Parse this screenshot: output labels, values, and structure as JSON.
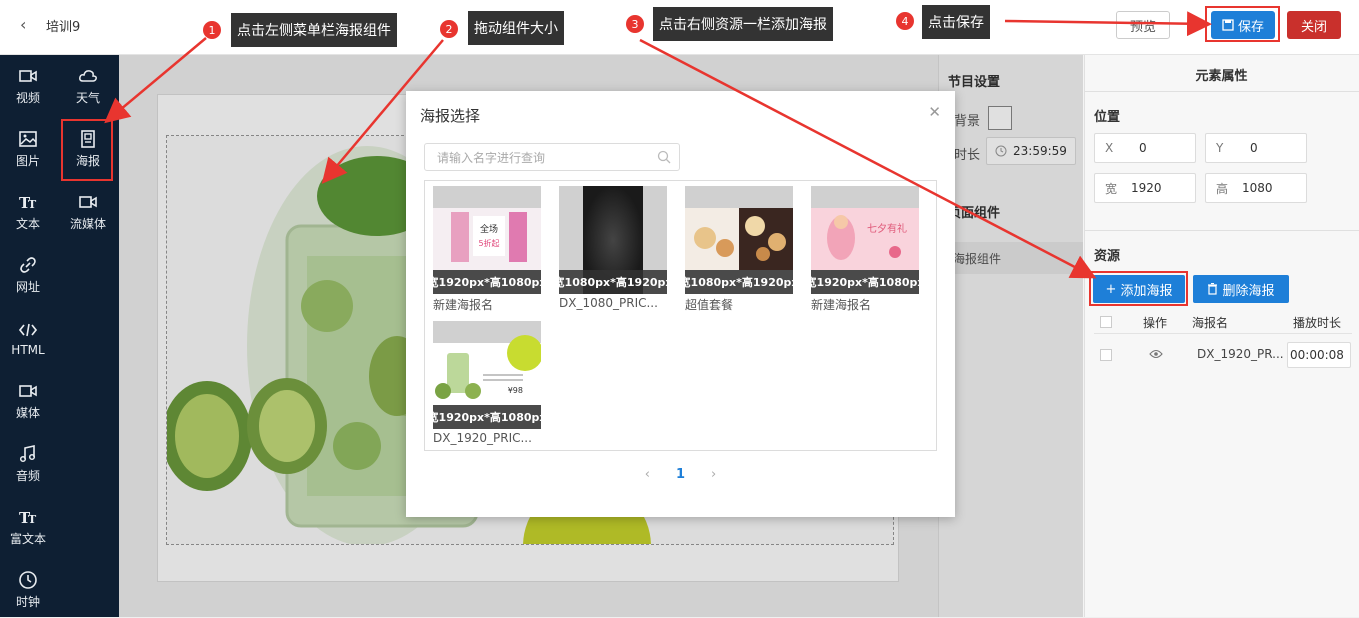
{
  "header": {
    "back_icon": "chevron-left-icon",
    "title": "培训9",
    "preview_label": "预览",
    "save_label": "保存",
    "close_label": "关闭"
  },
  "sidebar": {
    "items": [
      {
        "label": "视频",
        "icon": "video-icon"
      },
      {
        "label": "天气",
        "icon": "cloud-icon"
      },
      {
        "label": "图片",
        "icon": "image-icon"
      },
      {
        "label": "海报",
        "icon": "poster-icon"
      },
      {
        "label": "文本",
        "icon": "text-icon"
      },
      {
        "label": "流媒体",
        "icon": "stream-icon"
      },
      {
        "label": "网址",
        "icon": "link-icon"
      },
      {
        "label": "HTML",
        "icon": "code-icon"
      },
      {
        "label": "媒体",
        "icon": "media-icon"
      },
      {
        "label": "音频",
        "icon": "music-icon"
      },
      {
        "label": "富文本",
        "icon": "rich-text-icon"
      },
      {
        "label": "时钟",
        "icon": "clock-icon"
      }
    ]
  },
  "program": {
    "title": "节目设置",
    "bg_label": "背景",
    "duration_label": "时长",
    "duration": "23:59:59",
    "component_section": "页面组件",
    "component_item": "海报组件"
  },
  "element": {
    "title": "元素属性",
    "position_title": "位置",
    "x_label": "X",
    "x": "0",
    "y_label": "Y",
    "y": "0",
    "w_label": "宽",
    "w": "1920",
    "h_label": "高",
    "h": "1080",
    "resource_title": "资源",
    "add_label": "添加海报",
    "delete_label": "删除海报",
    "table": {
      "col_op": "操作",
      "col_name": "海报名",
      "col_dur": "播放时长",
      "row_name": "DX_1920_PR...",
      "row_dur": "00:00:08"
    }
  },
  "modal": {
    "title": "海报选择",
    "search_placeholder": "请输入名字进行查询",
    "posters": [
      {
        "size": "宽1920px*高1080px",
        "name": "新建海报名"
      },
      {
        "size": "宽1080px*高1920px",
        "name": "DX_1080_PRIC..."
      },
      {
        "size": "宽1080px*高1920px",
        "name": "超值套餐"
      },
      {
        "size": "宽1920px*高1080px",
        "name": "新建海报名"
      },
      {
        "size": "宽1920px*高1080px",
        "name": "DX_1920_PRIC..."
      }
    ],
    "poster_texts": {
      "p1_line1": "全场",
      "p1_line2": "5折起",
      "p4_text": "七夕有礼",
      "p5_price": "¥98"
    },
    "page": "1"
  },
  "annotations": [
    {
      "num": "1",
      "text": "点击左侧菜单栏海报组件"
    },
    {
      "num": "2",
      "text": "拖动组件大小"
    },
    {
      "num": "3",
      "text": "点击右侧资源一栏添加海报"
    },
    {
      "num": "4",
      "text": "点击保存"
    }
  ],
  "colors": {
    "sidebar_bg": "#0e1f33",
    "accent": "#1e7fd8",
    "danger": "#c9302c",
    "annotation": "#e8352f"
  }
}
